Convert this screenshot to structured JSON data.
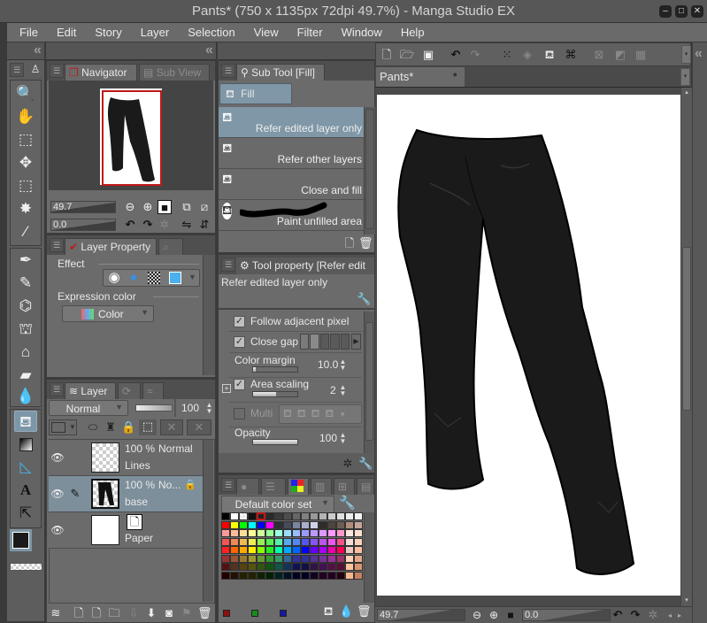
{
  "window": {
    "title": "Pants* (750 x 1135px 72dpi 49.7%)  - Manga Studio EX",
    "controls": [
      "minimize",
      "maximize",
      "close"
    ]
  },
  "menu": [
    "File",
    "Edit",
    "Story",
    "Layer",
    "Selection",
    "View",
    "Filter",
    "Window",
    "Help"
  ],
  "toolbar": {
    "icons": [
      "new-file-icon",
      "open-file-icon",
      "save-icon",
      "undo-icon",
      "redo-icon",
      "selection-points-icon",
      "transform-icon",
      "fill-icon",
      "crop-icon",
      "clear-selection-icon",
      "invert-selection-icon",
      "select-all-icon"
    ]
  },
  "document_tab": {
    "label": "Pants*"
  },
  "tools": [
    "zoom-icon",
    "hand-icon",
    "object-icon",
    "move-icon",
    "marquee-icon",
    "magic-wand-icon",
    "eyedropper-icon",
    "pen-icon",
    "pencil-icon",
    "airbrush-icon",
    "decoration-icon",
    "eraser-icon",
    "blend-icon",
    "fill-icon",
    "gradient-icon",
    "ruler-icon",
    "text-icon",
    "balloon-icon"
  ],
  "navigator": {
    "tabs": [
      "Navigator",
      "Sub View"
    ],
    "zoom_value": "49.7",
    "rotation_value": "0.0"
  },
  "layer_property": {
    "tab": "Layer Property",
    "effect_label": "Effect",
    "expression_color_label": "Expression color",
    "expression_color_value": "Color"
  },
  "layer_panel": {
    "tab": "Layer",
    "blend_mode": "Normal",
    "opacity": "100",
    "layers": [
      {
        "opacity": "100 %",
        "mode": "Normal",
        "name": "Lines",
        "visible": true,
        "selected": false
      },
      {
        "opacity": "100 %",
        "mode": "No...",
        "name": "base",
        "visible": true,
        "selected": true
      },
      {
        "opacity": "",
        "mode": "",
        "name": "Paper",
        "visible": true,
        "selected": false
      }
    ]
  },
  "sub_tool": {
    "tab": "Sub Tool [Fill]",
    "group": "Fill",
    "items": [
      {
        "label": "Refer edited layer only",
        "selected": true
      },
      {
        "label": "Refer other layers",
        "selected": false
      },
      {
        "label": "Close and fill",
        "selected": false
      },
      {
        "label": "Paint unfilled area",
        "selected": false
      }
    ]
  },
  "tool_property": {
    "tab": "Tool property [Refer edit",
    "preset_name": "Refer edited layer only",
    "follow_adjacent_pixel": {
      "label": "Follow adjacent pixel",
      "checked": true
    },
    "close_gap": {
      "label": "Close gap",
      "checked": true
    },
    "color_margin": {
      "label": "Color margin",
      "value": "10.0"
    },
    "area_scaling": {
      "label": "Area scaling",
      "value": "2",
      "checked": true
    },
    "multiple_referencing": {
      "label": "Multi",
      "checked": false
    },
    "opacity": {
      "label": "Opacity",
      "value": "100"
    }
  },
  "color_set": {
    "name": "Default color set",
    "recent": [
      "#8b1010",
      "#1a8a1a",
      "#1818a0"
    ]
  },
  "status": {
    "zoom": "49.7",
    "rotation": "0.0"
  },
  "colors": {
    "main": "#1a1a1a",
    "sub": "#ffffff",
    "selection_accent": "#7f97a7",
    "nav_frame": "#c01818"
  }
}
